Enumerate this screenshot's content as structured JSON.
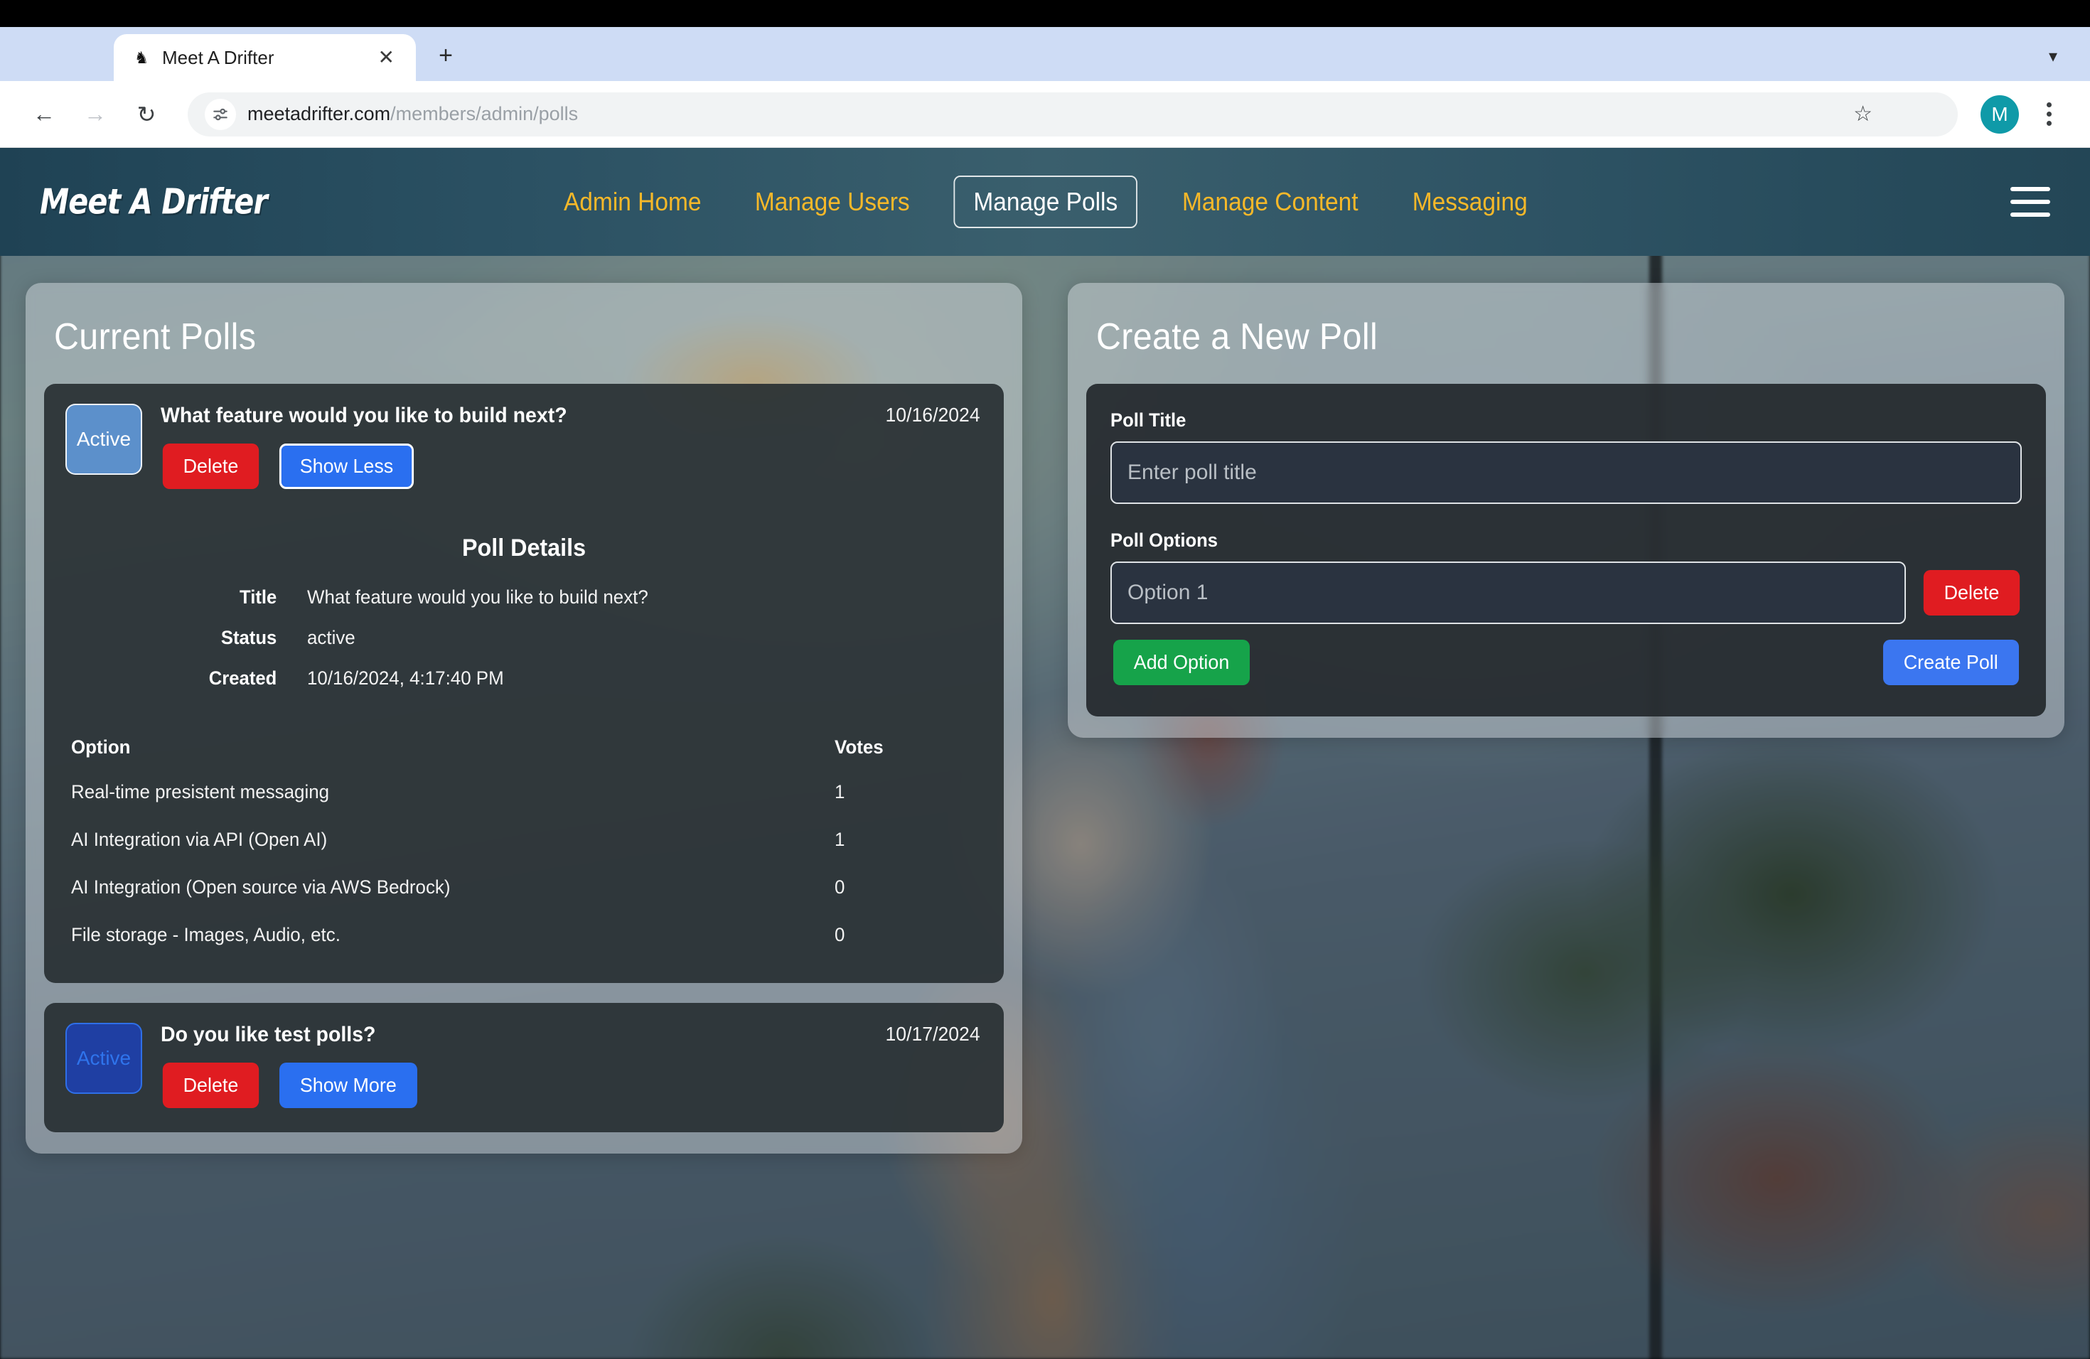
{
  "browser": {
    "tab": {
      "title": "Meet A Drifter",
      "favicon_icon": "rider-favicon",
      "close_icon": "close-icon"
    },
    "new_tab_icon": "plus-icon",
    "tab_list_icon": "chevron-down-icon",
    "back_icon": "back-arrow-icon",
    "forward_icon": "forward-arrow-icon",
    "reload_icon": "reload-icon",
    "site_info_icon": "site-settings-icon",
    "url_domain": "meetadrifter.com",
    "url_path": "/members/admin/polls",
    "bookmark_icon": "star-icon",
    "profile_initial": "M",
    "menu_icon": "kebab-menu-icon"
  },
  "site": {
    "brand": "Meet A Drifter",
    "nav": [
      {
        "label": "Admin Home",
        "active": false
      },
      {
        "label": "Manage Users",
        "active": false
      },
      {
        "label": "Manage Polls",
        "active": true
      },
      {
        "label": "Manage Content",
        "active": false
      },
      {
        "label": "Messaging",
        "active": false
      }
    ],
    "hamburger_icon": "hamburger-menu-icon",
    "accent_yellow": "#f6b829",
    "header_blue": "#2d5263"
  },
  "current_polls": {
    "title": "Current Polls",
    "polls": [
      {
        "status_badge": "Active",
        "badge_style": "light",
        "question": "What feature would you like to build next?",
        "date": "10/16/2024",
        "delete_label": "Delete",
        "toggle_label": "Show Less",
        "expanded": true,
        "details": {
          "heading": "Poll Details",
          "rows": [
            {
              "label": "Title",
              "value": "What feature would you like to build next?"
            },
            {
              "label": "Status",
              "value": "active"
            },
            {
              "label": "Created",
              "value": "10/16/2024, 4:17:40 PM"
            }
          ],
          "columns": {
            "option": "Option",
            "votes": "Votes"
          },
          "options": [
            {
              "name": "Real-time presistent messaging",
              "votes": "1"
            },
            {
              "name": "AI Integration via API (Open AI)",
              "votes": "1"
            },
            {
              "name": "AI Integration (Open source via AWS Bedrock)",
              "votes": "0"
            },
            {
              "name": "File storage - Images, Audio, etc.",
              "votes": "0"
            }
          ]
        }
      },
      {
        "status_badge": "Active",
        "badge_style": "deep",
        "question": "Do you like test polls?",
        "date": "10/17/2024",
        "delete_label": "Delete",
        "toggle_label": "Show More",
        "expanded": false
      }
    ]
  },
  "create_poll": {
    "title": "Create a New Poll",
    "poll_title_label": "Poll Title",
    "poll_title_placeholder": "Enter poll title",
    "poll_title_value": "",
    "poll_options_label": "Poll Options",
    "option_placeholder": "Option 1",
    "option_value": "",
    "option_delete_label": "Delete",
    "add_option_label": "Add Option",
    "create_poll_label": "Create Poll"
  },
  "colors": {
    "danger": "#e01c21",
    "primary_blue": "#2a6ff0",
    "success_green": "#16a34a",
    "badge_light": "#5c90cb",
    "badge_deep": "#1f3fa3",
    "avatar_teal": "#0f9aa8"
  }
}
